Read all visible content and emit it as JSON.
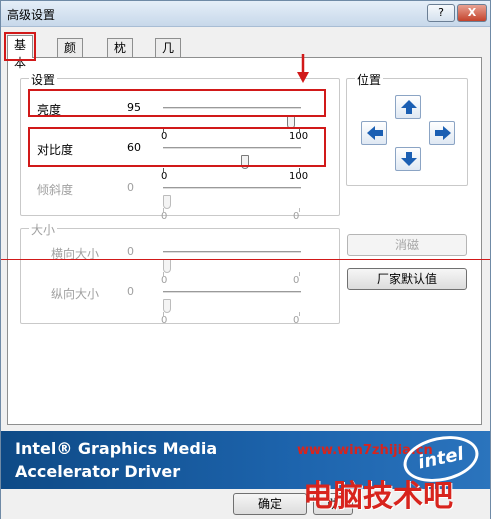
{
  "window": {
    "title": "高级设置",
    "help_label": "?",
    "close_label": "X"
  },
  "tabs": [
    {
      "label": "基本"
    },
    {
      "label": "颜色"
    },
    {
      "label": "枕形"
    },
    {
      "label": "几何特性"
    }
  ],
  "settings_group": {
    "label": "设置",
    "rows": [
      {
        "label": "亮度",
        "value": "95",
        "min": "0",
        "max": "100",
        "level": 0.95,
        "enabled": true
      },
      {
        "label": "对比度",
        "value": "60",
        "min": "0",
        "max": "100",
        "level": 0.6,
        "enabled": true
      },
      {
        "label": "倾斜度",
        "value": "0",
        "min": "0",
        "max": "0",
        "level": 0,
        "enabled": false
      }
    ]
  },
  "size_group": {
    "label": "大小",
    "rows": [
      {
        "label": "横向大小",
        "value": "0",
        "min": "0",
        "max": "0",
        "level": 0,
        "enabled": false
      },
      {
        "label": "纵向大小",
        "value": "0",
        "min": "0",
        "max": "0",
        "level": 0,
        "enabled": false
      }
    ]
  },
  "position_group": {
    "label": "位置",
    "up_icon": "arrow-up-icon",
    "left_icon": "arrow-left-icon",
    "right_icon": "arrow-right-icon",
    "down_icon": "arrow-down-icon"
  },
  "buttons": {
    "cancel_label": "消磁",
    "defaults_label": "厂家默认值",
    "ok_label": "确定",
    "apply_label": "助"
  },
  "banner": {
    "line1": "Intel® Graphics Media",
    "line2": "Accelerator Driver",
    "logo_text": "intel",
    "watermark_url": "www.win7zhijia.cn"
  },
  "watermark": {
    "text": "电脑技术吧"
  },
  "colors": {
    "highlight_red": "#d11919",
    "banner_blue": "#1d64ad"
  }
}
